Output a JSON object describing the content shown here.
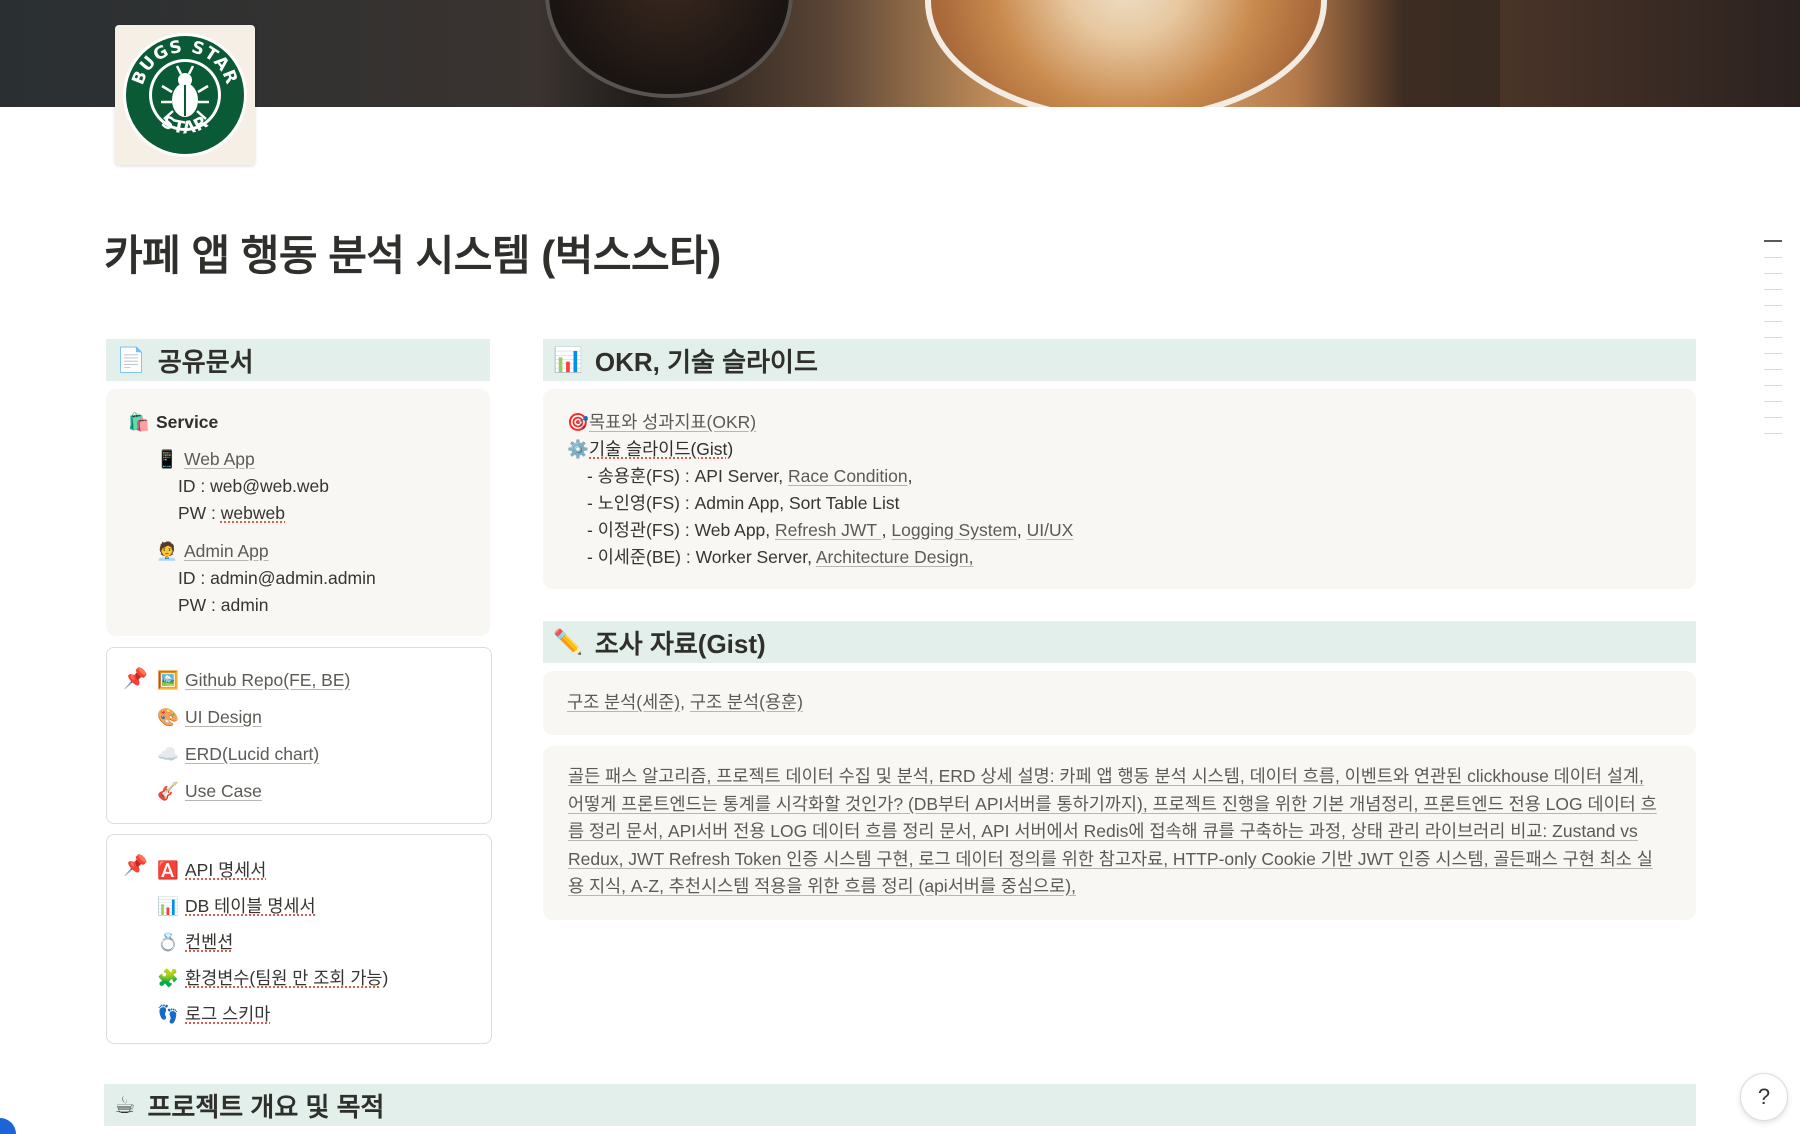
{
  "title": "카페 앱 행동 분석 시스템 (벅스스타)",
  "logo": {
    "top_text": "BUGS STAR",
    "bottom_text": "STAR"
  },
  "shared_docs": {
    "heading": "공유문서",
    "icon": "page-icon",
    "service": {
      "label": "Service",
      "web_app": {
        "label": "Web App",
        "id": "ID : web@web.web",
        "pw_prefix": "PW : ",
        "pw": "webweb"
      },
      "admin_app": {
        "label": "Admin App",
        "id": "ID : admin@admin.admin",
        "pw": "PW : admin"
      }
    },
    "links_group": [
      "Github Repo(FE, BE)",
      "UI Design",
      "ERD(Lucid chart)",
      "Use Case"
    ],
    "specs_group": [
      "API 명세서",
      "DB 테이블 명세서",
      "컨벤션",
      "환경변수(팀원 만 조회 가능)",
      "로그 스키마"
    ]
  },
  "okr": {
    "heading": "OKR, 기술 슬라이드",
    "goal_link": "목표와 성과지표(OKR)",
    "slides_label": "기술 슬라이드(Gist)",
    "members": [
      {
        "prefix": "- 송용훈(FS) : API Server, ",
        "links": [
          "Race Condition"
        ],
        "suffix": ","
      },
      {
        "prefix": "- 노인영(FS) : Admin App, Sort Table List",
        "links": [],
        "suffix": ""
      },
      {
        "prefix": "- 이정관(FS) : Web App, ",
        "links": [
          "Refresh JWT ",
          "Logging System",
          "UI/UX"
        ],
        "suffix": ""
      },
      {
        "prefix": "- 이세준(BE) : Worker Server, ",
        "links": [
          "Architecture Design,"
        ],
        "suffix": ""
      }
    ]
  },
  "research": {
    "heading": "조사 자료(Gist)",
    "structure_links": [
      "구조 분석(세준)",
      "구조 분석(용훈)"
    ],
    "paragraph": "골든 패스 알고리즘,  프로젝트 데이터 수집 및 분석,  ERD 상세 설명: 카페 앱 행동 분석 시스템, 데이터 흐름, 이벤트와 연관된 clickhouse 데이터 설계, 어떻게 프론트엔드는 통계를 시각화할 것인가? (DB부터 API서버를 통하기까지), 프로젝트 진행을 위한 기본 개념정리, 프론트엔드 전용 LOG 데이터 흐름 정리 문서, API서버 전용 LOG 데이터 흐름 정리 문서,  API 서버에서 Redis에 접속해 큐를 구축하는 과정, 상태 관리 라이브러리 비교: Zustand vs Redux, JWT Refresh Token 인증 시스템 구현, 로그 데이터 정의를 위한 참고자료, HTTP-only Cookie 기반 JWT 인증 시스템, 골든패스 구현 최소 실용 지식, A-Z, 추천시스템 적용을 위한 흐름 정리 (api서버를 중심으로),"
  },
  "overview": {
    "heading": "프로젝트 개요 및 목적"
  },
  "colors": {
    "section_bg": "#e3efea",
    "card_bg": "#f8f7f4",
    "text": "#37352f",
    "link": "#5c5a55"
  }
}
